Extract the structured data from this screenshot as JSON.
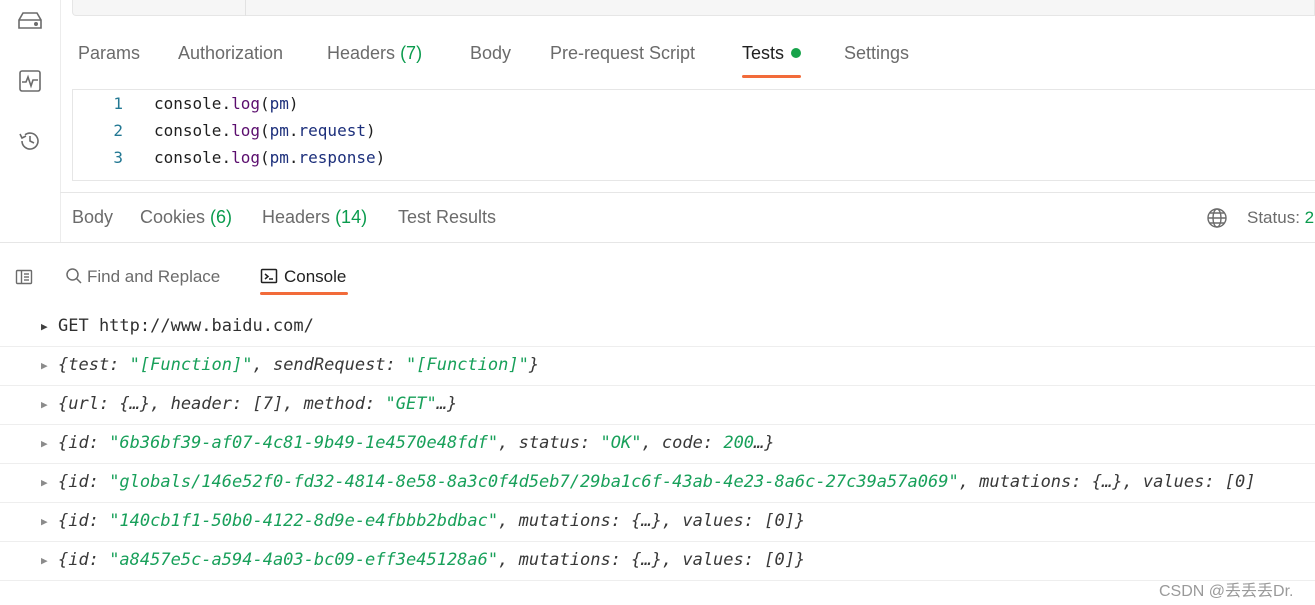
{
  "request_tabs": [
    {
      "label": "Params"
    },
    {
      "label": "Authorization"
    },
    {
      "label": "Headers",
      "count": "(7)"
    },
    {
      "label": "Body"
    },
    {
      "label": "Pre-request Script"
    },
    {
      "label": "Tests",
      "active": true
    },
    {
      "label": "Settings"
    }
  ],
  "editor": {
    "lines": [
      {
        "num": "1",
        "obj": "console",
        "fn": "log",
        "arg_root": "pm",
        "arg_prop": ""
      },
      {
        "num": "2",
        "obj": "console",
        "fn": "log",
        "arg_root": "pm",
        "arg_prop": "request"
      },
      {
        "num": "3",
        "obj": "console",
        "fn": "log",
        "arg_root": "pm",
        "arg_prop": "response"
      }
    ]
  },
  "response_tabs": [
    {
      "label": "Body"
    },
    {
      "label": "Cookies",
      "count": "(6)"
    },
    {
      "label": "Headers",
      "count": "(14)"
    },
    {
      "label": "Test Results"
    }
  ],
  "status": {
    "label": "Status:",
    "code": "2"
  },
  "console_bar": {
    "find_label": "Find and Replace",
    "console_label": "Console"
  },
  "logs": [
    {
      "plain": "GET http://www.baidu.com/"
    },
    {
      "text": "{test: \"[Function]\", sendRequest: \"[Function]\"}"
    },
    {
      "text": "{url: {…}, header: [7], method: \"GET\"…}"
    },
    {
      "text": "{id: \"6b36bf39-af07-4c81-9b49-1e4570e48fdf\", status: \"OK\", code: 200…}"
    },
    {
      "text": "{id: \"globals/146e52f0-fd32-4814-8e58-8a3c0f4d5eb7/29ba1c6f-43ab-4e23-8a6c-27c39a57a069\", mutations: {…}, values: [0]"
    },
    {
      "text": "{id: \"140cb1f1-50b0-4122-8d9e-e4fbbb2bdbac\", mutations: {…}, values: [0]}"
    },
    {
      "text": "{id: \"a8457e5c-a594-4a03-bc09-eff3e45128a6\", mutations: {…}, values: [0]}"
    }
  ],
  "watermark": "CSDN @丢丢丢Dr.",
  "colors": {
    "accent": "#f26b3a",
    "count_green": "#0a9b4d",
    "string_green": "#18a05a",
    "dot_green": "#17a34a"
  },
  "icons": [
    "storage-icon",
    "activity-icon",
    "history-icon",
    "globe-icon",
    "sidebar-pane-icon",
    "search-icon",
    "console-icon",
    "expand-arrow-icon"
  ]
}
